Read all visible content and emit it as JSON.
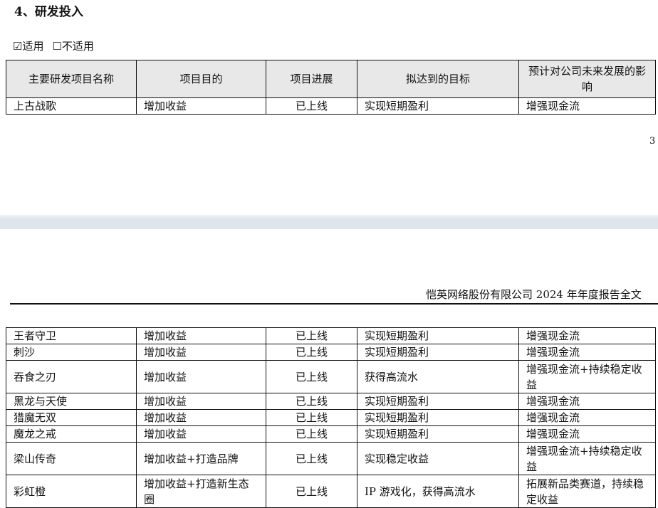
{
  "section_title": "4、研发投入",
  "applicability": {
    "applicable": "☑适用",
    "not_applicable": "☐不适用"
  },
  "page_number": "3",
  "company_report_title": "恺英网络股份有限公司 2024 年年度报告全文",
  "table": {
    "headers": [
      "主要研发项目名称",
      "项目目的",
      "项目进展",
      "拟达到的目标",
      "预计对公司未来发展的影响"
    ],
    "rows_page1": [
      [
        "上古战歌",
        "增加收益",
        "已上线",
        "实现短期盈利",
        "增强现金流"
      ]
    ],
    "rows_page2": [
      [
        "王者守卫",
        "增加收益",
        "已上线",
        "实现短期盈利",
        "增强现金流"
      ],
      [
        "刺沙",
        "增加收益",
        "已上线",
        "实现短期盈利",
        "增强现金流"
      ],
      [
        "吞食之刃",
        "增加收益",
        "已上线",
        "获得高流水",
        "增强现金流+持续稳定收益"
      ],
      [
        "黑龙与天使",
        "增加收益",
        "已上线",
        "实现短期盈利",
        "增强现金流"
      ],
      [
        "猎魔无双",
        "增加收益",
        "已上线",
        "实现短期盈利",
        "增强现金流"
      ],
      [
        "魔龙之戒",
        "增加收益",
        "已上线",
        "实现短期盈利",
        "增强现金流"
      ],
      [
        "梁山传奇",
        "增加收益+打造品牌",
        "已上线",
        "实现稳定收益",
        "增强现金流+持续稳定收益"
      ],
      [
        "彩虹橙",
        "增加收益+打造新生态圈",
        "已上线",
        "IP 游戏化，获得高流水",
        "拓展新品类赛道，持续稳定收益"
      ]
    ]
  }
}
